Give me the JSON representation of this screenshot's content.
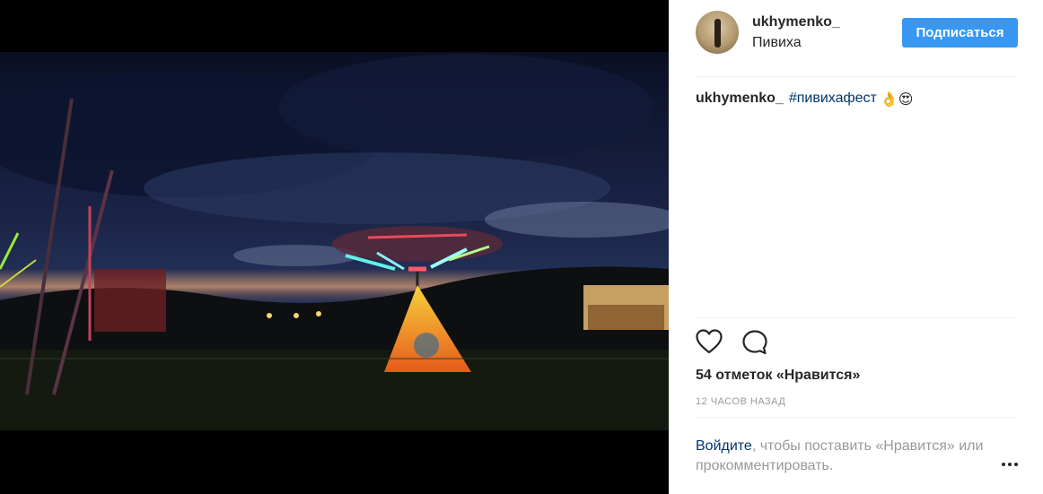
{
  "post": {
    "username": "ukhymenko_",
    "location": "Пивиха",
    "follow_label": "Подписаться",
    "caption_user": "ukhymenko_",
    "caption_tag": "#пивихафест",
    "caption_emoji": "👌😍",
    "likes_text": "54 отметок «Нравится»",
    "time_text": "12 ЧАСОВ НАЗАД",
    "login_link": "Войдите",
    "login_rest": ", чтобы поставить «Нравится» или прокомментировать."
  },
  "icons": {
    "like": "heart-icon",
    "comment": "comment-icon",
    "more": "more-options-icon",
    "avatar": "user-avatar"
  },
  "colors": {
    "accent": "#3897f0",
    "link": "#003569",
    "muted": "#999999",
    "text": "#262626"
  }
}
